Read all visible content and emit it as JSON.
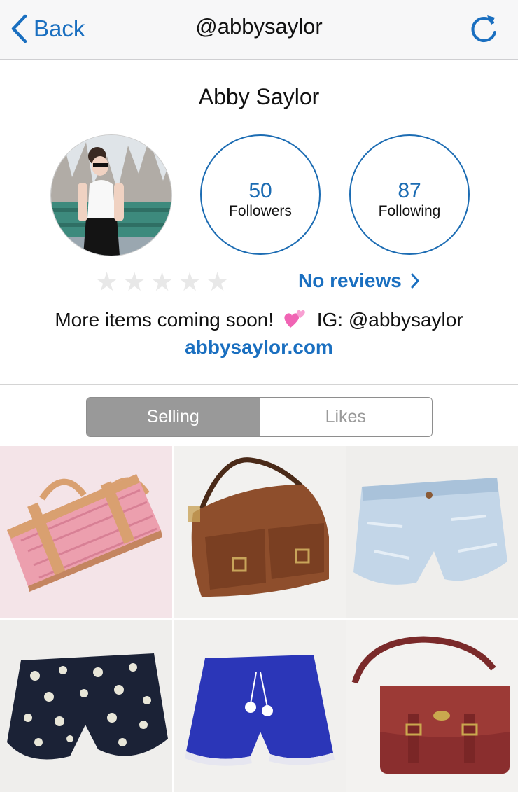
{
  "navbar": {
    "back_label": "Back",
    "title": "@abbysaylor",
    "refresh_icon": "refresh-icon"
  },
  "profile": {
    "name": "Abby Saylor",
    "followers_count": "50",
    "followers_label": "Followers",
    "following_count": "87",
    "following_label": "Following",
    "rating_stars": 0,
    "reviews_label": "No reviews",
    "bio_text": "More items coming soon!",
    "bio_suffix": "IG: @abbysaylor",
    "website": "abbysaylor.com"
  },
  "tabs": {
    "selling": "Selling",
    "likes": "Likes",
    "active": "Selling"
  },
  "items": [
    {
      "name": "pink-monogram-handbag"
    },
    {
      "name": "brown-leather-hobo-bag"
    },
    {
      "name": "light-wash-denim-shorts"
    },
    {
      "name": "navy-floral-shorts"
    },
    {
      "name": "royal-blue-lace-shorts"
    },
    {
      "name": "burgundy-leather-satchel"
    }
  ],
  "colors": {
    "accent": "#1a6fc0",
    "stat_ring": "#1c6cb3",
    "segment_active": "#999999"
  }
}
